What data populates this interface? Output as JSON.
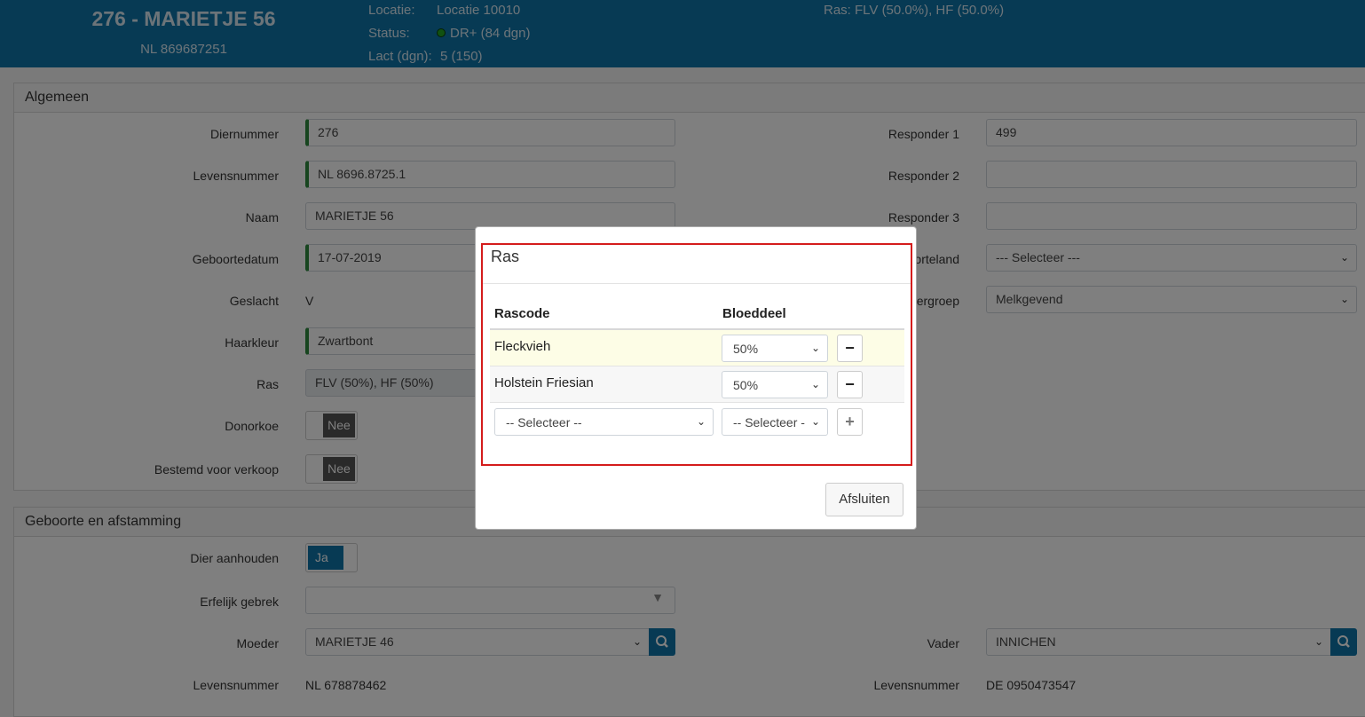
{
  "header": {
    "title": "276 - MARIETJE 56",
    "subtitle": "NL 869687251",
    "locatie_label": "Locatie:",
    "locatie_value": "Locatie 10010",
    "status_label": "Status:",
    "status_value": "DR+ (84 dgn)",
    "lact_label": "Lact (dgn):",
    "lact_value": "5 (150)",
    "ras_label": "Ras:",
    "ras_value": "FLV (50.0%), HF (50.0%)"
  },
  "algemeen": {
    "title": "Algemeen",
    "diernummer_label": "Diernummer",
    "diernummer_value": "276",
    "levensnummer_label": "Levensnummer",
    "levensnummer_value": "NL 8696.8725.1",
    "naam_label": "Naam",
    "naam_value": "MARIETJE 56",
    "geboortedatum_label": "Geboortedatum",
    "geboortedatum_value": "17-07-2019",
    "geslacht_label": "Geslacht",
    "geslacht_value": "V",
    "haarkleur_label": "Haarkleur",
    "haarkleur_value": "Zwartbont",
    "ras_label": "Ras",
    "ras_value": "FLV (50%), HF (50%)",
    "donorkoe_label": "Donorkoe",
    "donorkoe_value": "Nee",
    "verkoop_label": "Bestemd voor verkoop",
    "verkoop_value": "Nee",
    "responder1_label": "Responder 1",
    "responder1_value": "499",
    "responder2_label": "Responder 2",
    "responder3_label": "Responder 3",
    "geboorteland_label": "orteland",
    "geboorteland_value": "--- Selecteer ---",
    "diergroep_label": "ergroep",
    "diergroep_value": "Melkgevend"
  },
  "geboorte": {
    "title": "Geboorte en afstamming",
    "aanhouden_label": "Dier aanhouden",
    "aanhouden_value": "Ja",
    "gebrek_label": "Erfelijk gebrek",
    "moeder_label": "Moeder",
    "moeder_value": "MARIETJE 46",
    "vader_label": "Vader",
    "vader_value": "INNICHEN",
    "moeder_levensnummer_label": "Levensnummer",
    "moeder_levensnummer_value": "NL 678878462",
    "vader_levensnummer_label": "Levensnummer",
    "vader_levensnummer_value": "DE 0950473547"
  },
  "modal": {
    "title": "Ras",
    "col_rascode": "Rascode",
    "col_bloeddeel": "Bloeddeel",
    "rows": [
      {
        "rascode": "Fleckvieh",
        "bloeddeel": "50%"
      },
      {
        "rascode": "Holstein Friesian",
        "bloeddeel": "50%"
      }
    ],
    "new_rascode_placeholder": "-- Selecteer --",
    "new_bloeddeel_placeholder": "-- Selecteer -",
    "close_label": "Afsluiten"
  },
  "icons": {
    "remove": "minus-icon",
    "add": "plus-icon",
    "search": "search-icon",
    "dropdown": "chevron-down-icon",
    "status": "status-dot-icon"
  },
  "colors": {
    "header_bg": "#0f75a8",
    "required_marker": "#2e8b3e",
    "modal_highlight": "#d41c1c",
    "status_dot": "#22a322"
  }
}
